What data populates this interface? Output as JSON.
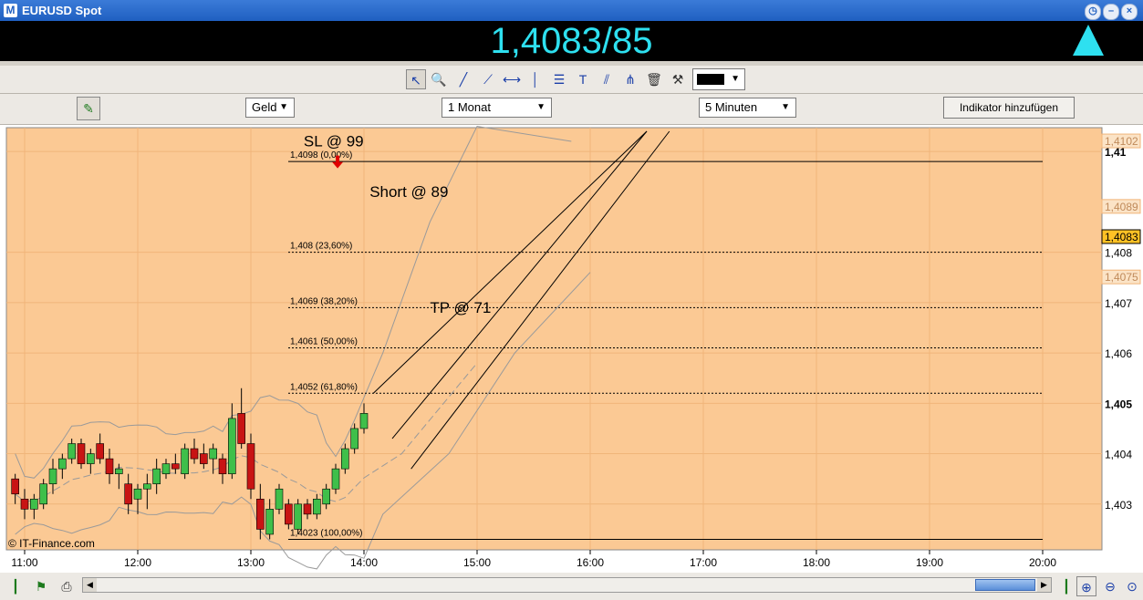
{
  "window": {
    "title": "EURUSD Spot",
    "icon": "window-app-icon"
  },
  "quote": {
    "price": "1,4083/85",
    "direction": "up",
    "color": "#2ee0f0"
  },
  "toolbar": {
    "tools": [
      "pointer-icon",
      "zoom-icon",
      "trendline-icon",
      "ray-icon",
      "horizontal-line-icon",
      "vertical-line-icon",
      "fibonacci-icon",
      "text-icon",
      "channel-icon",
      "pitchfork-icon",
      "trash-icon",
      "tools-icon"
    ],
    "color": "#000000"
  },
  "settings": {
    "price_type": "Geld",
    "period": "1 Monat",
    "interval": "5 Minuten",
    "add_indicator": "Indikator hinzufügen"
  },
  "chart_data": {
    "type": "candlestick",
    "background": "#fbc994",
    "watermark": "© IT-Finance.com",
    "x_ticks": [
      "11:00",
      "12:00",
      "13:00",
      "14:00",
      "15:00",
      "16:00",
      "17:00",
      "18:00",
      "19:00",
      "20:00"
    ],
    "y_ticks": [
      "1,403",
      "1,404",
      "1,405",
      "1,406",
      "1,407",
      "1,408",
      "1,41"
    ],
    "y_labels_bold": [
      "1,405",
      "1,41"
    ],
    "ylim": [
      1.4022,
      1.4104
    ],
    "xlim_minutes_from_11": [
      -10,
      215
    ],
    "price_tags": [
      {
        "value": 1.4102,
        "label": "1,4102",
        "style": "faded"
      },
      {
        "value": 1.4089,
        "label": "1,4089",
        "style": "faded"
      },
      {
        "value": 1.4083,
        "label": "1,4083",
        "style": "current"
      },
      {
        "value": 1.4075,
        "label": "1,4075",
        "style": "faded"
      }
    ],
    "fibonacci": [
      {
        "value": 1.4098,
        "label": "1,4098 (0,00%)"
      },
      {
        "value": 1.408,
        "label": "1,408 (23,60%)"
      },
      {
        "value": 1.4069,
        "label": "1,4069 (38,20%)"
      },
      {
        "value": 1.4061,
        "label": "1,4061 (50,00%)"
      },
      {
        "value": 1.4052,
        "label": "1,4052 (61,80%)"
      },
      {
        "value": 1.4023,
        "label": "1,4023 (100,00%)"
      }
    ],
    "annotations": [
      {
        "text": "SL @ 99",
        "t": 148,
        "v": 1.4101
      },
      {
        "text": "Short @ 89",
        "t": 183,
        "v": 1.4091
      },
      {
        "text": "TP @ 71",
        "t": 215,
        "v": 1.4068
      }
    ],
    "signal_arrow": {
      "t": 166,
      "v": 1.4097,
      "color": "#e00000"
    },
    "candles": [
      {
        "t": -5,
        "o": 1.4035,
        "h": 1.4036,
        "l": 1.403,
        "c": 1.4032
      },
      {
        "t": 0,
        "o": 1.4031,
        "h": 1.4033,
        "l": 1.4027,
        "c": 1.4029
      },
      {
        "t": 5,
        "o": 1.4029,
        "h": 1.4032,
        "l": 1.4027,
        "c": 1.4031
      },
      {
        "t": 10,
        "o": 1.403,
        "h": 1.4035,
        "l": 1.4029,
        "c": 1.4034
      },
      {
        "t": 15,
        "o": 1.4034,
        "h": 1.4039,
        "l": 1.4032,
        "c": 1.4037
      },
      {
        "t": 20,
        "o": 1.4037,
        "h": 1.404,
        "l": 1.4035,
        "c": 1.4039
      },
      {
        "t": 25,
        "o": 1.4039,
        "h": 1.4043,
        "l": 1.4038,
        "c": 1.4042
      },
      {
        "t": 30,
        "o": 1.4042,
        "h": 1.4043,
        "l": 1.4037,
        "c": 1.4038
      },
      {
        "t": 35,
        "o": 1.4038,
        "h": 1.4041,
        "l": 1.4036,
        "c": 1.404
      },
      {
        "t": 40,
        "o": 1.4042,
        "h": 1.4044,
        "l": 1.4038,
        "c": 1.4039
      },
      {
        "t": 45,
        "o": 1.4039,
        "h": 1.4041,
        "l": 1.4034,
        "c": 1.4036
      },
      {
        "t": 50,
        "o": 1.4036,
        "h": 1.4038,
        "l": 1.4033,
        "c": 1.4037
      },
      {
        "t": 55,
        "o": 1.4034,
        "h": 1.4036,
        "l": 1.4028,
        "c": 1.403
      },
      {
        "t": 60,
        "o": 1.4031,
        "h": 1.4034,
        "l": 1.4028,
        "c": 1.4033
      },
      {
        "t": 65,
        "o": 1.4033,
        "h": 1.4036,
        "l": 1.4029,
        "c": 1.4034
      },
      {
        "t": 70,
        "o": 1.4034,
        "h": 1.4039,
        "l": 1.4032,
        "c": 1.4037
      },
      {
        "t": 75,
        "o": 1.4036,
        "h": 1.4039,
        "l": 1.4035,
        "c": 1.4038
      },
      {
        "t": 80,
        "o": 1.4038,
        "h": 1.404,
        "l": 1.4036,
        "c": 1.4037
      },
      {
        "t": 85,
        "o": 1.4036,
        "h": 1.4042,
        "l": 1.4035,
        "c": 1.4041
      },
      {
        "t": 90,
        "o": 1.4041,
        "h": 1.4043,
        "l": 1.4038,
        "c": 1.4039
      },
      {
        "t": 95,
        "o": 1.404,
        "h": 1.4042,
        "l": 1.4037,
        "c": 1.4038
      },
      {
        "t": 100,
        "o": 1.4039,
        "h": 1.4042,
        "l": 1.4036,
        "c": 1.4041
      },
      {
        "t": 105,
        "o": 1.4039,
        "h": 1.404,
        "l": 1.4034,
        "c": 1.4036
      },
      {
        "t": 110,
        "o": 1.4036,
        "h": 1.405,
        "l": 1.4035,
        "c": 1.4047
      },
      {
        "t": 115,
        "o": 1.4048,
        "h": 1.4053,
        "l": 1.4041,
        "c": 1.4042
      },
      {
        "t": 120,
        "o": 1.4042,
        "h": 1.4044,
        "l": 1.4031,
        "c": 1.4033
      },
      {
        "t": 125,
        "o": 1.4031,
        "h": 1.4034,
        "l": 1.4023,
        "c": 1.4025
      },
      {
        "t": 130,
        "o": 1.4024,
        "h": 1.4031,
        "l": 1.4023,
        "c": 1.4029
      },
      {
        "t": 135,
        "o": 1.4029,
        "h": 1.4034,
        "l": 1.4028,
        "c": 1.4033
      },
      {
        "t": 140,
        "o": 1.403,
        "h": 1.4031,
        "l": 1.4025,
        "c": 1.4026
      },
      {
        "t": 145,
        "o": 1.4025,
        "h": 1.4031,
        "l": 1.4024,
        "c": 1.403
      },
      {
        "t": 150,
        "o": 1.403,
        "h": 1.4031,
        "l": 1.4027,
        "c": 1.4028
      },
      {
        "t": 155,
        "o": 1.4028,
        "h": 1.4032,
        "l": 1.4027,
        "c": 1.4031
      },
      {
        "t": 160,
        "o": 1.403,
        "h": 1.4034,
        "l": 1.4029,
        "c": 1.4033
      },
      {
        "t": 165,
        "o": 1.4033,
        "h": 1.4038,
        "l": 1.4032,
        "c": 1.4037
      },
      {
        "t": 170,
        "o": 1.4037,
        "h": 1.4042,
        "l": 1.4036,
        "c": 1.4041
      },
      {
        "t": 175,
        "o": 1.4041,
        "h": 1.4046,
        "l": 1.404,
        "c": 1.4045
      },
      {
        "t": 180,
        "o": 1.4045,
        "h": 1.405,
        "l": 1.4044,
        "c": 1.4048
      }
    ],
    "series": []
  }
}
